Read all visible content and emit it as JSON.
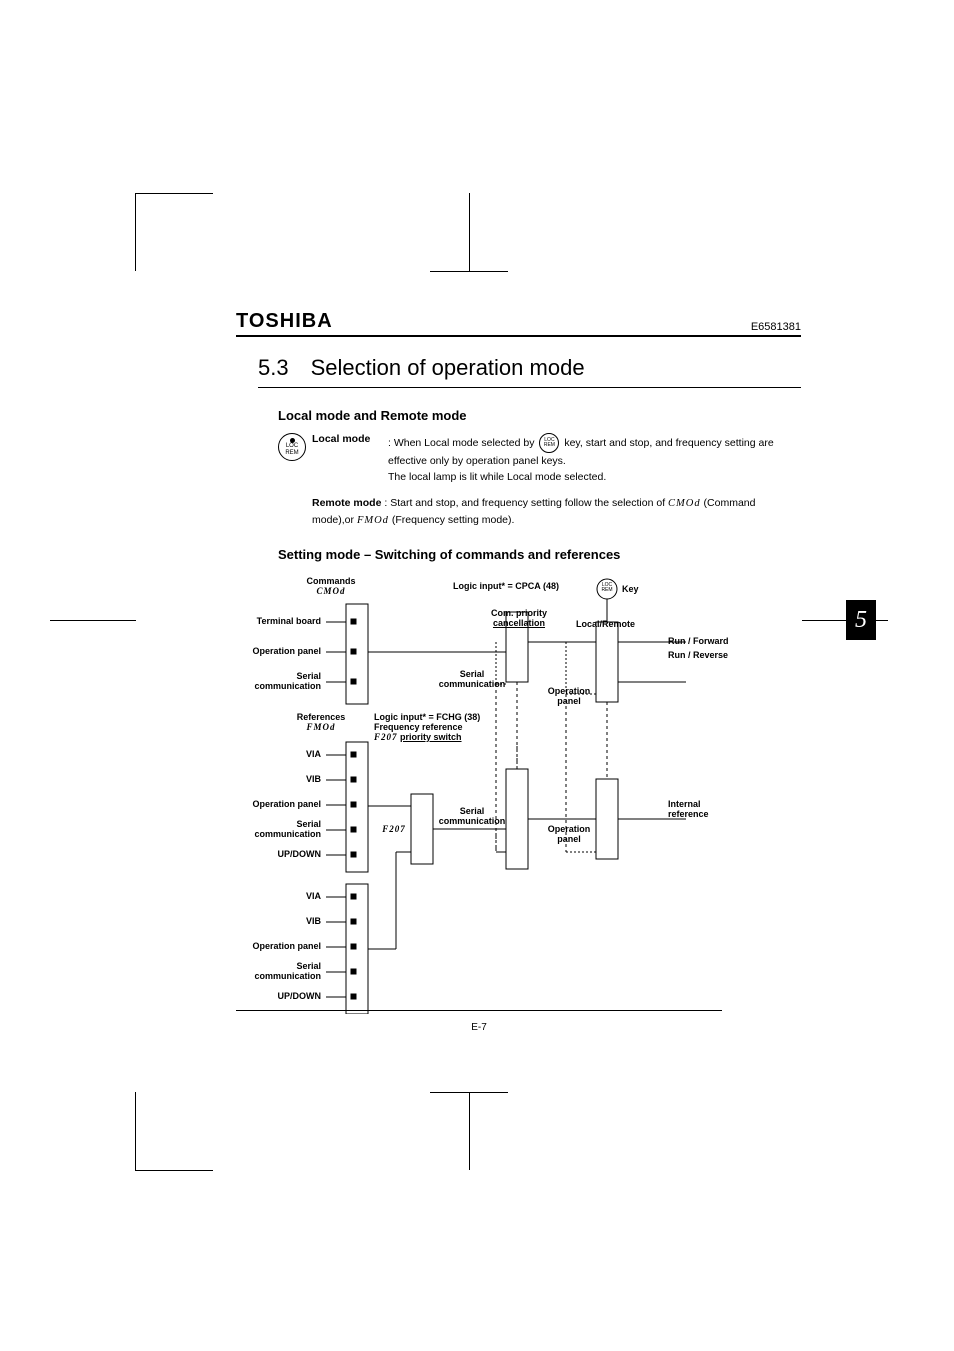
{
  "doc_number": "E6581381",
  "brand": "TOSHIBA",
  "section_number": "5.3",
  "section_title": "Selection of operation mode",
  "subhead1": "Local mode and Remote mode",
  "local": {
    "label": "Local mode",
    "line1": ": When Local mode selected by ",
    "line1_tail": " key, start and stop, and frequency setting are",
    "line2": "effective only by operation panel keys.",
    "line3": "The local lamp is lit while Local mode selected."
  },
  "remote": {
    "label": "Remote mode",
    "line1_head": " : Start and stop, and frequency setting follow the selection of ",
    "cmod": "CMOd",
    "line1_tail": "(Command",
    "line2_head": "mode),or ",
    "fmod": "FMOd",
    "line2_tail": "(Frequency setting mode)."
  },
  "subhead2": "Setting mode – Switching of commands and references",
  "diagram": {
    "commands_title": "Commands",
    "cmod": "CMOd",
    "terminal_board": "Terminal board",
    "operation_panel": "Operation panel",
    "serial_comm": "Serial",
    "serial_comm2": "communication",
    "logic_cpca": "Logic input* = CPCA (48)",
    "key_label": "Key",
    "com_priority": "Com. priority",
    "cancellation": "cancellation",
    "local_remote": "Local/Remote",
    "run_fwd": "Run / Forward",
    "run_rev": "Run / Reverse",
    "references_title": "References",
    "fmod": "FMOd",
    "via": "VIA",
    "vib": "VIB",
    "updown": "UP/DOWN",
    "logic_fchg": "Logic input* = FCHG (38)",
    "freq_ref": "Frequency reference",
    "f207_switch": "priority switch",
    "f207": "F207",
    "internal_ref": "Internal",
    "internal_ref2": "reference",
    "operation": "Operation",
    "panel": "panel"
  },
  "page_number": "E-7",
  "chapter_badge": "5",
  "key": {
    "top": "LOC",
    "bot": "REM"
  }
}
